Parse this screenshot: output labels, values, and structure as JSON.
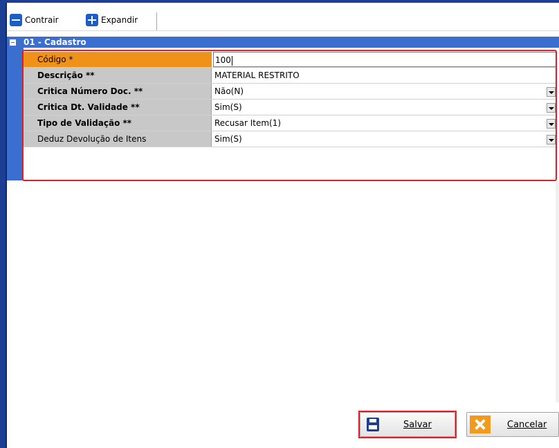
{
  "toolbar": {
    "collapse_label": "Contrair",
    "expand_label": "Expandir"
  },
  "section": {
    "title": "01 - Cadastro"
  },
  "fields": [
    {
      "label": "Código *",
      "value": "100",
      "type": "text",
      "active": true
    },
    {
      "label": "Descrição **",
      "value": "MATERIAL RESTRITO",
      "type": "text"
    },
    {
      "label": "Critica Número Doc. **",
      "value": "Não(N)",
      "type": "select"
    },
    {
      "label": "Critica Dt. Validade **",
      "value": "Sim(S)",
      "type": "select"
    },
    {
      "label": "Tipo de Validação **",
      "value": "Recusar Item(1)",
      "type": "select"
    },
    {
      "label": "Deduz Devolução de Itens",
      "value": "Sim(S)",
      "type": "select"
    }
  ],
  "buttons": {
    "save_label": "Salvar",
    "cancel_label": "Cancelar"
  },
  "colors": {
    "frame_blue": "#1c3f94",
    "section_blue": "#3b6fcf",
    "active_orange": "#f0921a",
    "highlight_red": "#e01e2a"
  }
}
